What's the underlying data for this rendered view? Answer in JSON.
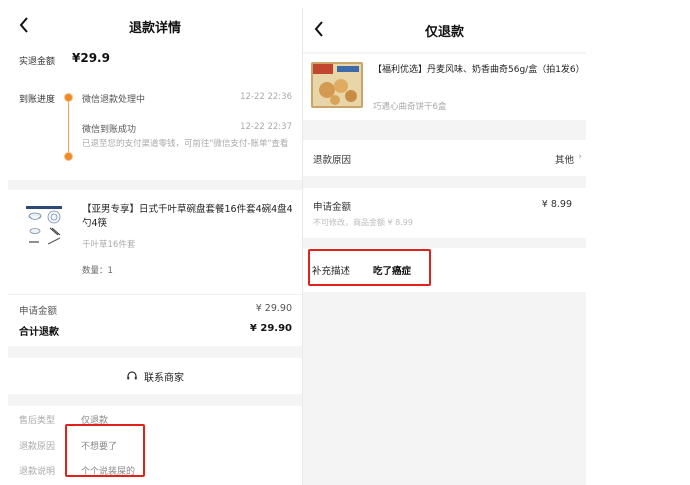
{
  "left": {
    "nav": {
      "title": "退款详情"
    },
    "refund": {
      "label": "实退金额",
      "amount": "¥29.9"
    },
    "progress": {
      "label": "到账进度",
      "steps": [
        {
          "text": "微信退款处理中",
          "time": "12-22 22:36"
        },
        {
          "text": "微信到账成功",
          "time": "12-22 22:37"
        }
      ],
      "note": "已退至您的支付渠道零钱，可前往\"微信支付-账单\"查看"
    },
    "product": {
      "name": "【亚男专享】日式千叶草碗盘套餐16件套4碗4盘4勺4筷",
      "spec": "千叶草16件套",
      "qty": "数量：1"
    },
    "totals": {
      "apply_label": "申请金额",
      "apply_value": "¥ 29.90",
      "total_label": "合计退款",
      "total_value": "¥ 29.90"
    },
    "contact": {
      "label": "联系商家"
    },
    "info": {
      "rows": [
        {
          "k": "售后类型",
          "v": "仅退款"
        },
        {
          "k": "退款原因",
          "v": "不想要了"
        },
        {
          "k": "退款说明",
          "v": "个个说装屎的"
        }
      ]
    }
  },
  "right": {
    "nav": {
      "title": "仅退款"
    },
    "product": {
      "name": "【福利优选】丹麦风味、奶香曲奇56g/盒（拍1发6）",
      "spec": "巧遇心曲奇饼干6盒"
    },
    "reason": {
      "label": "退款原因",
      "value": "其他"
    },
    "amount": {
      "label": "申请金额",
      "value": "¥ 8.99",
      "sub": "不可修改，商品金额 ¥ 8.99"
    },
    "desc": {
      "label": "补充描述",
      "value": "吃了癌症"
    }
  },
  "colors": {
    "accent": "#f08a24",
    "highlight": "#e0221b"
  }
}
